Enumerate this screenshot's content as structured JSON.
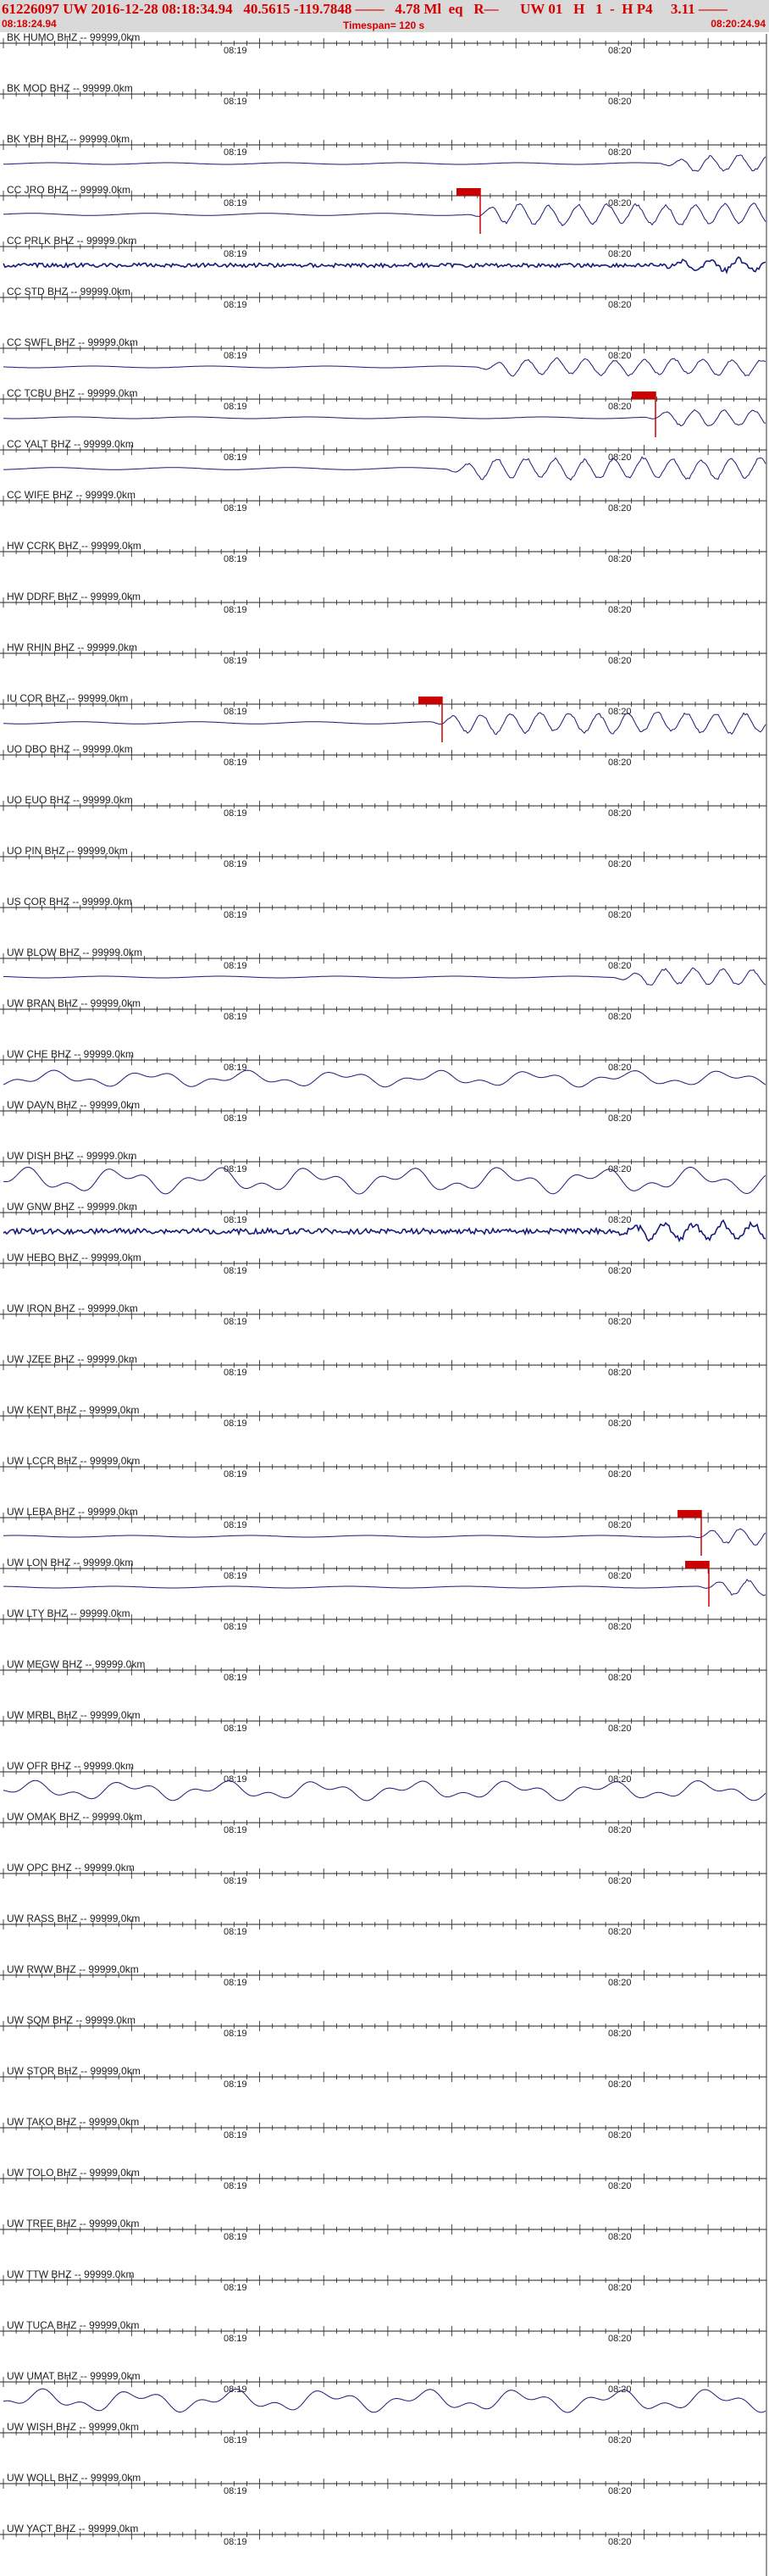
{
  "header": {
    "line1": "61226097 UW 2016-12-28 08:18:34.94   40.5615 -119.7848 ——   4.78 Ml  eq   R—      UW 01   H   1  -  H P4     3.11 ——",
    "start_time": "08:18:24.94",
    "end_time": "08:20:24.94",
    "timespan": "Timespan= 120 s"
  },
  "time_labels": [
    "08:19",
    "08:20"
  ],
  "colors": {
    "trace": "#1a1a7a",
    "pick": "#cc0000",
    "header_text": "#d40000",
    "header_bg": "#d9d9d9"
  },
  "traces": [
    {
      "label": "BK HUMO BHZ -- 99999.0km",
      "amp": 0,
      "onset": 1,
      "pick": false,
      "style": "none"
    },
    {
      "label": "BK MOD BHZ -- 99999.0km",
      "amp": 0,
      "onset": 1,
      "pick": false,
      "style": "none"
    },
    {
      "label": "BK YBH BHZ -- 99999.0km",
      "amp": 4,
      "onset": 0.86,
      "pick": false,
      "style": "smooth"
    },
    {
      "label": "CC JRO BHZ -- 99999.0km",
      "amp": 5,
      "onset": 0.61,
      "pick": true,
      "style": "quake"
    },
    {
      "label": "CC PRLK BHZ -- 99999.0km",
      "amp": 3,
      "onset": 0.86,
      "pick": false,
      "style": "noisy"
    },
    {
      "label": "CC STD BHZ -- 99999.0km",
      "amp": 0,
      "onset": 1,
      "pick": false,
      "style": "none"
    },
    {
      "label": "CC SWFL BHZ -- 99999.0km",
      "amp": 4,
      "onset": 0.62,
      "pick": false,
      "style": "quake"
    },
    {
      "label": "CC TCBU BHZ -- 99999.0km",
      "amp": 4,
      "onset": 0.84,
      "pick": true,
      "style": "quake"
    },
    {
      "label": "CC YALT BHZ -- 99999.0km",
      "amp": 5,
      "onset": 0.58,
      "pick": false,
      "style": "quake"
    },
    {
      "label": "CC WIFE BHZ -- 99999.0km",
      "amp": 0,
      "onset": 1,
      "pick": false,
      "style": "none"
    },
    {
      "label": "HW CCRK BHZ -- 99999.0km",
      "amp": 0,
      "onset": 1,
      "pick": false,
      "style": "none"
    },
    {
      "label": "HW DDRF BHZ -- 99999.0km",
      "amp": 0,
      "onset": 1,
      "pick": false,
      "style": "none"
    },
    {
      "label": "HW RHIN BHZ -- 99999.0km",
      "amp": 0,
      "onset": 1,
      "pick": false,
      "style": "none"
    },
    {
      "label": "IU COR BHZ -- 99999.0km",
      "amp": 5,
      "onset": 0.56,
      "pick": true,
      "style": "quake"
    },
    {
      "label": "UO DBO BHZ -- 99999.0km",
      "amp": 0,
      "onset": 1,
      "pick": false,
      "style": "none"
    },
    {
      "label": "UO EUO BHZ -- 99999.0km",
      "amp": 0,
      "onset": 1,
      "pick": false,
      "style": "none"
    },
    {
      "label": "UO PIN BHZ -- 99999.0km",
      "amp": 0,
      "onset": 1,
      "pick": false,
      "style": "none"
    },
    {
      "label": "US COR BHZ -- 99999.0km",
      "amp": 0,
      "onset": 1,
      "pick": false,
      "style": "none"
    },
    {
      "label": "UW BLOW BHZ -- 99999.0km",
      "amp": 4,
      "onset": 0.8,
      "pick": false,
      "style": "quake"
    },
    {
      "label": "UW BRAN BHZ -- 99999.0km",
      "amp": 0,
      "onset": 1,
      "pick": false,
      "style": "none"
    },
    {
      "label": "UW CHE BHZ -- 99999.0km",
      "amp": 10,
      "onset": 1,
      "pick": false,
      "style": "smooth"
    },
    {
      "label": "UW DAVN BHZ -- 99999.0km",
      "amp": 0,
      "onset": 1,
      "pick": false,
      "style": "none"
    },
    {
      "label": "UW DISH BHZ -- 99999.0km",
      "amp": 16,
      "onset": 1,
      "pick": false,
      "style": "smooth"
    },
    {
      "label": "UW GNW BHZ -- 99999.0km",
      "amp": 4,
      "onset": 0.8,
      "pick": false,
      "style": "noisy"
    },
    {
      "label": "UW HEBO BHZ -- 99999.0km",
      "amp": 0,
      "onset": 1,
      "pick": false,
      "style": "none"
    },
    {
      "label": "UW IRON BHZ -- 99999.0km",
      "amp": 0,
      "onset": 1,
      "pick": false,
      "style": "none"
    },
    {
      "label": "UW JZEE BHZ -- 99999.0km",
      "amp": 0,
      "onset": 1,
      "pick": false,
      "style": "none"
    },
    {
      "label": "UW KENT BHZ -- 99999.0km",
      "amp": 0,
      "onset": 1,
      "pick": false,
      "style": "none"
    },
    {
      "label": "UW LCCR BHZ -- 99999.0km",
      "amp": 0,
      "onset": 1,
      "pick": false,
      "style": "none"
    },
    {
      "label": "UW LEBA BHZ -- 99999.0km",
      "amp": 4,
      "onset": 0.9,
      "pick": true,
      "style": "quake"
    },
    {
      "label": "UW LON BHZ -- 99999.0km",
      "amp": 4,
      "onset": 0.91,
      "pick": true,
      "style": "quake"
    },
    {
      "label": "UW LTY BHZ -- 99999.0km",
      "amp": 0,
      "onset": 1,
      "pick": false,
      "style": "none"
    },
    {
      "label": "UW MEGW BHZ -- 99999.0km",
      "amp": 0,
      "onset": 1,
      "pick": false,
      "style": "none"
    },
    {
      "label": "UW MRBL BHZ -- 99999.0km",
      "amp": 0,
      "onset": 1,
      "pick": false,
      "style": "none"
    },
    {
      "label": "UW OFR BHZ -- 99999.0km",
      "amp": 12,
      "onset": 1,
      "pick": false,
      "style": "smooth"
    },
    {
      "label": "UW OMAK BHZ -- 99999.0km",
      "amp": 0,
      "onset": 1,
      "pick": false,
      "style": "none"
    },
    {
      "label": "UW OPC BHZ -- 99999.0km",
      "amp": 0,
      "onset": 1,
      "pick": false,
      "style": "none"
    },
    {
      "label": "UW RASS BHZ -- 99999.0km",
      "amp": 0,
      "onset": 1,
      "pick": false,
      "style": "none"
    },
    {
      "label": "UW RWW BHZ -- 99999.0km",
      "amp": 0,
      "onset": 1,
      "pick": false,
      "style": "none"
    },
    {
      "label": "UW SQM BHZ -- 99999.0km",
      "amp": 0,
      "onset": 1,
      "pick": false,
      "style": "none"
    },
    {
      "label": "UW STOR BHZ -- 99999.0km",
      "amp": 0,
      "onset": 1,
      "pick": false,
      "style": "none"
    },
    {
      "label": "UW TAKO BHZ -- 99999.0km",
      "amp": 0,
      "onset": 1,
      "pick": false,
      "style": "none"
    },
    {
      "label": "UW TOLO BHZ -- 99999.0km",
      "amp": 0,
      "onset": 1,
      "pick": false,
      "style": "none"
    },
    {
      "label": "UW TREE BHZ -- 99999.0km",
      "amp": 0,
      "onset": 1,
      "pick": false,
      "style": "none"
    },
    {
      "label": "UW TTW BHZ -- 99999.0km",
      "amp": 0,
      "onset": 1,
      "pick": false,
      "style": "none"
    },
    {
      "label": "UW TUCA BHZ -- 99999.0km",
      "amp": 0,
      "onset": 1,
      "pick": false,
      "style": "none"
    },
    {
      "label": "UW UMAT BHZ -- 99999.0km",
      "amp": 14,
      "onset": 1,
      "pick": false,
      "style": "smooth"
    },
    {
      "label": "UW WISH BHZ -- 99999.0km",
      "amp": 0,
      "onset": 1,
      "pick": false,
      "style": "none"
    },
    {
      "label": "UW WOLL BHZ -- 99999.0km",
      "amp": 0,
      "onset": 1,
      "pick": false,
      "style": "none"
    },
    {
      "label": "UW YACT BHZ -- 99999.0km",
      "amp": 0,
      "onset": 1,
      "pick": false,
      "style": "none"
    }
  ]
}
